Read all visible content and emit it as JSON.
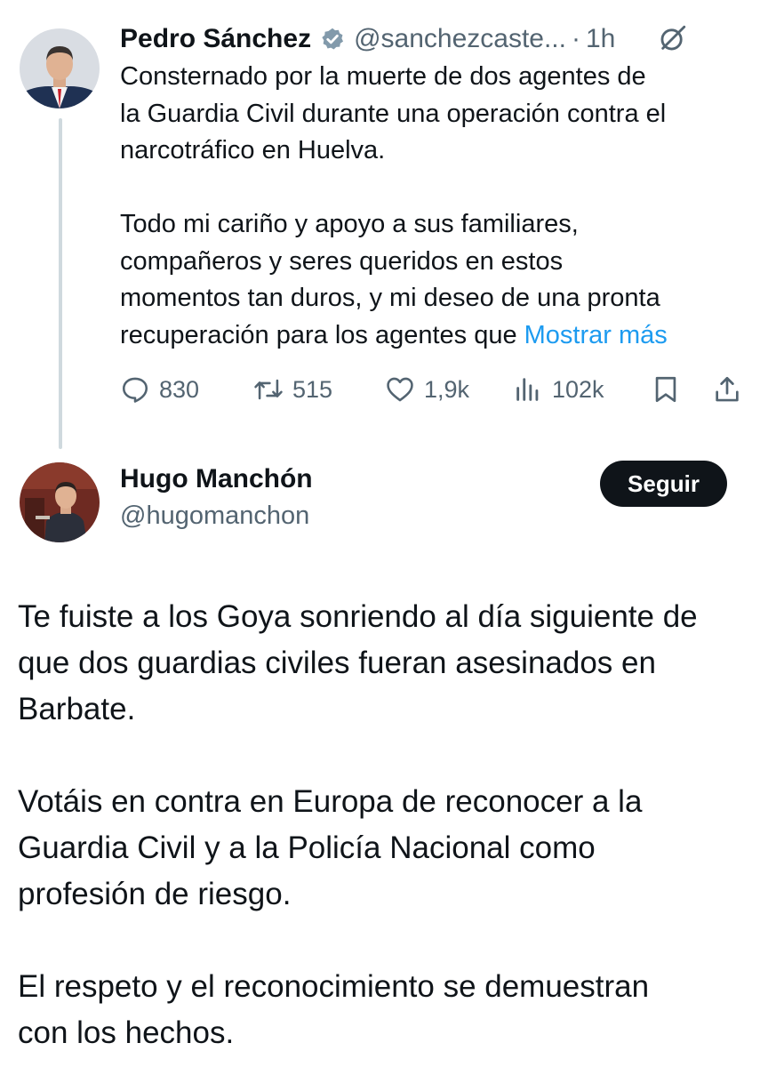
{
  "original_tweet": {
    "author_name": "Pedro Sánchez",
    "author_handle": "@sanchezcaste...",
    "separator": "·",
    "time": "1h",
    "body_lines": [
      "Consternado por la muerte de dos agentes de",
      "la Guardia Civil durante una operación contra el",
      "narcotráfico en Huelva."
    ],
    "body_lines_2": [
      "Todo mi cariño y apoyo a sus familiares,",
      "compañeros y seres queridos en estos",
      "momentos tan duros, y mi deseo de una pronta"
    ],
    "last_line": "recuperación para los agentes que ",
    "show_more": "Mostrar más",
    "stats": {
      "replies": "830",
      "reposts": "515",
      "likes": "1,9k",
      "views": "102k"
    },
    "icons": [
      "verified-badge-icon",
      "grok-icon",
      "reply-icon",
      "repost-icon",
      "like-icon",
      "views-icon",
      "bookmark-icon",
      "share-icon"
    ],
    "verified_color": "#829aab"
  },
  "reply": {
    "author_name": "Hugo Manchón",
    "author_handle": "@hugomanchon",
    "follow_label": "Seguir",
    "paragraph_1": [
      "Te fuiste a los Goya sonriendo al día siguiente de",
      "que dos guardias civiles fueran asesinados en",
      "Barbate."
    ],
    "paragraph_2": [
      "Votáis en contra en Europa de reconocer a la",
      "Guardia Civil y a la Policía Nacional como",
      "profesión de riesgo."
    ],
    "paragraph_3": [
      "El respeto y el reconocimiento se demuestran",
      "con los hechos."
    ]
  },
  "colors": {
    "text": "#0f1419",
    "secondary": "#536471",
    "link": "#1d9bf0",
    "thread_line": "#cfd9de",
    "follow_bg": "#0f1419"
  }
}
